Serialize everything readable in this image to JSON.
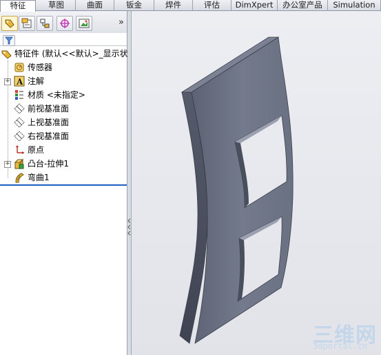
{
  "tabs": [
    {
      "label": "特征",
      "active": true
    },
    {
      "label": "草图"
    },
    {
      "label": "曲面"
    },
    {
      "label": "钣金"
    },
    {
      "label": "焊件"
    },
    {
      "label": "评估"
    },
    {
      "label": "DimXpert"
    },
    {
      "label": "办公室产品"
    },
    {
      "label": "Simulation"
    }
  ],
  "manager_tabs": [
    {
      "icon": "feature-manager-icon",
      "active": true
    },
    {
      "icon": "property-manager-icon"
    },
    {
      "icon": "configuration-manager-icon"
    },
    {
      "icon": "dimxpert-manager-icon"
    },
    {
      "icon": "display-manager-icon"
    }
  ],
  "expand_label": "»",
  "tree": {
    "root": "特征件 (默认<<默认>_显示状",
    "items": [
      {
        "label": "传感器",
        "icon": "sensor-icon"
      },
      {
        "label": "注解",
        "icon": "annotation-icon",
        "expandable": true
      },
      {
        "label": "材质 <未指定>",
        "icon": "material-icon"
      },
      {
        "label": "前视基准面",
        "icon": "plane-icon"
      },
      {
        "label": "上视基准面",
        "icon": "plane-icon"
      },
      {
        "label": "右视基准面",
        "icon": "plane-icon"
      },
      {
        "label": "原点",
        "icon": "origin-icon"
      },
      {
        "label": "凸台-拉伸1",
        "icon": "extrude-icon",
        "expandable": true
      },
      {
        "label": "弯曲1",
        "icon": "flex-icon"
      }
    ]
  },
  "watermark": {
    "logo": "三维网",
    "url": "3dportal.cn"
  },
  "colors": {
    "part_face": "#6f7586",
    "part_side": "#4b5060",
    "accent": "#1d5fbf"
  }
}
